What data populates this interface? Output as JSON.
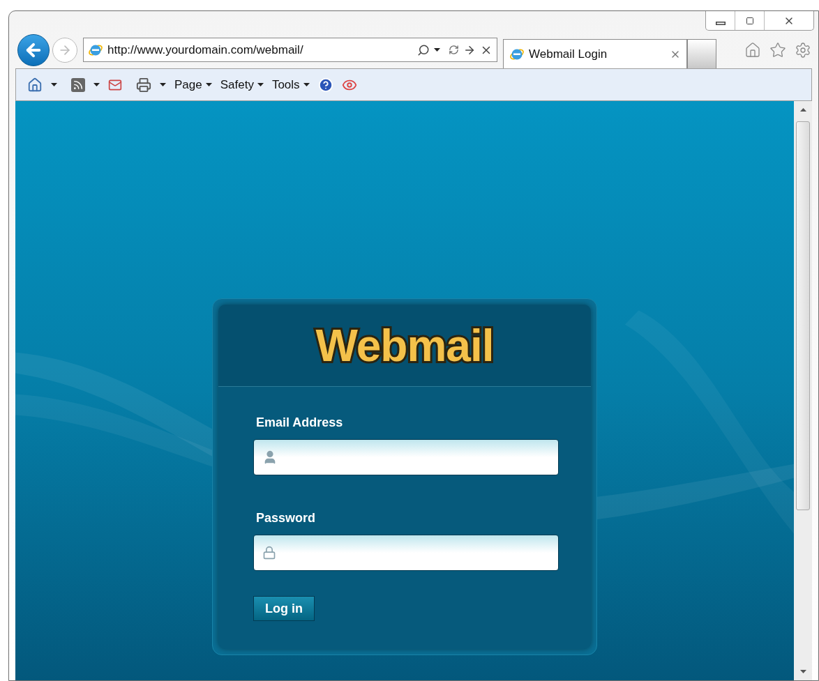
{
  "browser": {
    "address": "http://www.yourdomain.com/webmail/",
    "tabs": [
      {
        "title": "Webmail Login",
        "selected": true
      }
    ],
    "command_bar": [
      {
        "label": "Page"
      },
      {
        "label": "Safety"
      },
      {
        "label": "Tools"
      }
    ]
  },
  "login": {
    "logo": "Webmail",
    "fields": [
      {
        "label": "Email Address",
        "kind": "user"
      },
      {
        "label": "Password",
        "kind": "lock"
      }
    ],
    "button": "Log in"
  }
}
